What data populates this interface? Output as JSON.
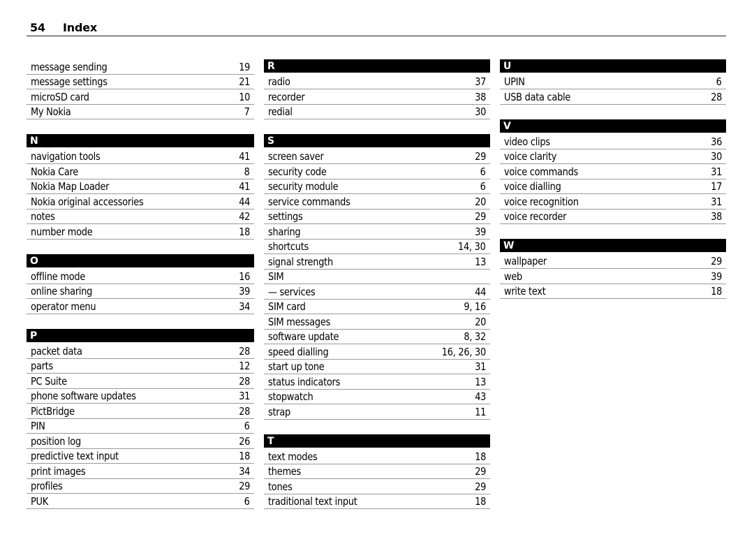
{
  "header": {
    "page_number": "54",
    "title": "Index"
  },
  "columns": [
    {
      "sections": [
        {
          "letter": "",
          "entries": [
            {
              "term": "message sending",
              "pages": "19"
            },
            {
              "term": "message settings",
              "pages": "21"
            },
            {
              "term": "microSD card",
              "pages": "10"
            },
            {
              "term": "My Nokia",
              "pages": "7"
            }
          ]
        },
        {
          "letter": "N",
          "entries": [
            {
              "term": "navigation tools",
              "pages": "41"
            },
            {
              "term": "Nokia Care",
              "pages": "8"
            },
            {
              "term": "Nokia Map Loader",
              "pages": "41"
            },
            {
              "term": "Nokia original accessories",
              "pages": "44"
            },
            {
              "term": "notes",
              "pages": "42"
            },
            {
              "term": "number mode",
              "pages": "18"
            }
          ]
        },
        {
          "letter": "O",
          "entries": [
            {
              "term": "offline mode",
              "pages": "16"
            },
            {
              "term": "online sharing",
              "pages": "39"
            },
            {
              "term": "operator menu",
              "pages": "34"
            }
          ]
        },
        {
          "letter": "P",
          "entries": [
            {
              "term": "packet data",
              "pages": "28"
            },
            {
              "term": "parts",
              "pages": "12"
            },
            {
              "term": "PC Suite",
              "pages": "28"
            },
            {
              "term": "phone software updates",
              "pages": "31"
            },
            {
              "term": "PictBridge",
              "pages": "28"
            },
            {
              "term": "PIN",
              "pages": "6"
            },
            {
              "term": "position log",
              "pages": "26"
            },
            {
              "term": "predictive text input",
              "pages": "18"
            },
            {
              "term": "print images",
              "pages": "34"
            },
            {
              "term": "profiles",
              "pages": "29"
            },
            {
              "term": "PUK",
              "pages": "6"
            }
          ]
        }
      ]
    },
    {
      "sections": [
        {
          "letter": "R",
          "entries": [
            {
              "term": "radio",
              "pages": "37"
            },
            {
              "term": "recorder",
              "pages": "38"
            },
            {
              "term": "redial",
              "pages": "30"
            }
          ]
        },
        {
          "letter": "S",
          "entries": [
            {
              "term": "screen saver",
              "pages": "29"
            },
            {
              "term": "security code",
              "pages": "6"
            },
            {
              "term": "security module",
              "pages": "6"
            },
            {
              "term": "service commands",
              "pages": "20"
            },
            {
              "term": "settings",
              "pages": "29"
            },
            {
              "term": "sharing",
              "pages": "39"
            },
            {
              "term": "shortcuts",
              "pages": "14, 30"
            },
            {
              "term": "signal strength",
              "pages": "13"
            },
            {
              "term": "SIM",
              "pages": ""
            },
            {
              "term": "—   services",
              "pages": "44"
            },
            {
              "term": "SIM card",
              "pages": "9, 16"
            },
            {
              "term": "SIM messages",
              "pages": "20"
            },
            {
              "term": "software update",
              "pages": "8, 32"
            },
            {
              "term": "speed dialling",
              "pages": "16, 26, 30"
            },
            {
              "term": "start up tone",
              "pages": "31"
            },
            {
              "term": "status indicators",
              "pages": "13"
            },
            {
              "term": "stopwatch",
              "pages": "43"
            },
            {
              "term": "strap",
              "pages": "11"
            }
          ]
        },
        {
          "letter": "T",
          "entries": [
            {
              "term": "text modes",
              "pages": "18"
            },
            {
              "term": "themes",
              "pages": "29"
            },
            {
              "term": "tones",
              "pages": "29"
            },
            {
              "term": "traditional text input",
              "pages": "18"
            }
          ]
        }
      ]
    },
    {
      "sections": [
        {
          "letter": "U",
          "entries": [
            {
              "term": "UPIN",
              "pages": "6"
            },
            {
              "term": "USB data cable",
              "pages": "28"
            }
          ]
        },
        {
          "letter": "V",
          "entries": [
            {
              "term": "video clips",
              "pages": "36"
            },
            {
              "term": "voice clarity",
              "pages": "30"
            },
            {
              "term": "voice commands",
              "pages": "31"
            },
            {
              "term": "voice dialling",
              "pages": "17"
            },
            {
              "term": "voice recognition",
              "pages": "31"
            },
            {
              "term": "voice recorder",
              "pages": "38"
            }
          ]
        },
        {
          "letter": "W",
          "entries": [
            {
              "term": "wallpaper",
              "pages": "29"
            },
            {
              "term": "web",
              "pages": "39"
            },
            {
              "term": "write text",
              "pages": "18"
            }
          ]
        }
      ]
    }
  ]
}
